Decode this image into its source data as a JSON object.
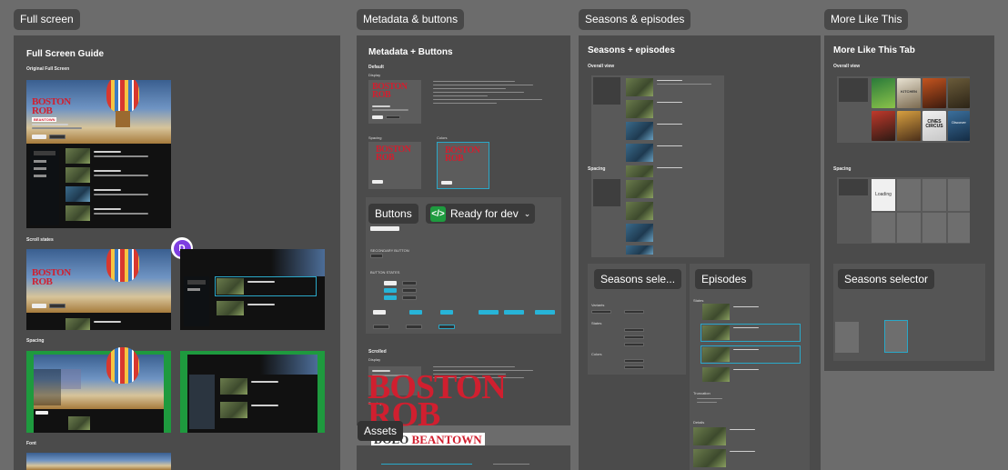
{
  "sections": {
    "full_screen": "Full screen",
    "metadata": "Metadata & buttons",
    "seasons": "Seasons & episodes",
    "more_like": "More Like This"
  },
  "full": {
    "title": "Full Screen Guide",
    "original": "Original Full Screen",
    "scroll": "Scroll states",
    "spacing": "Spacing",
    "font": "Font",
    "avatar": "D",
    "show_top": "BOSTON",
    "show_bottom": "ROB",
    "show_tag": "BEANTOWN"
  },
  "meta": {
    "title": "Metadata + Buttons",
    "default": "Default",
    "display": "Display",
    "spacing": "Spacing",
    "colors": "Colors",
    "buttons_tag": "Buttons",
    "ready": "Ready for dev",
    "secondary": "SECONDARY BUTTON",
    "button_states": "BUTTON STATES",
    "scrolled": "Scrolled",
    "assets": "Assets"
  },
  "seasons": {
    "title": "Seasons + episodes",
    "overview": "Overall view",
    "spacing": "Spacing",
    "selector_tag": "Seasons sele...",
    "episodes_tag": "Episodes",
    "variants": "Variants",
    "states": "States",
    "colors": "Colors",
    "truncation": "Truncation",
    "details": "Details"
  },
  "more": {
    "title": "More Like This Tab",
    "overview": "Overall view",
    "spacing": "Spacing",
    "selector_tag": "Seasons selector",
    "loading": "Loading",
    "cover1": "KITCHEN",
    "cover2": "CINES CIRCUS",
    "cover3": "Discover"
  }
}
